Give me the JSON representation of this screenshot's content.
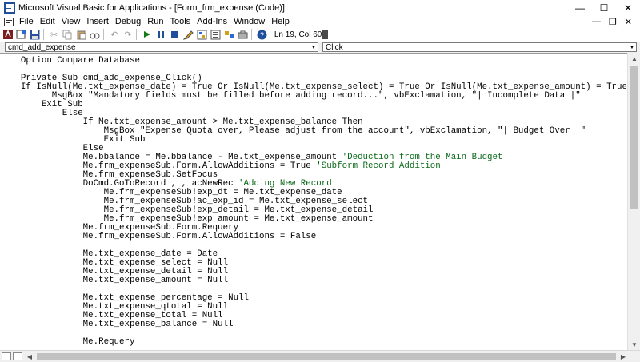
{
  "window": {
    "title": "Microsoft Visual Basic for Applications - [Form_frm_expense (Code)]",
    "minimize": "—",
    "maximize": "☐",
    "close": "✕"
  },
  "menu": {
    "items": [
      "File",
      "Edit",
      "View",
      "Insert",
      "Debug",
      "Run",
      "Tools",
      "Add-Ins",
      "Window",
      "Help"
    ],
    "mdi_min": "—",
    "mdi_restore": "❐",
    "mdi_close": "✕"
  },
  "toolbar": {
    "status": "Ln 19, Col 60"
  },
  "dropdowns": {
    "object": "cmd_add_expense",
    "procedure": "Click"
  },
  "code": [
    {
      "t": "    Option Compare Database",
      "c": ""
    },
    {
      "t": "",
      "c": ""
    },
    {
      "t": "    Private Sub cmd_add_expense_Click()",
      "c": ""
    },
    {
      "t": "    If IsNull(Me.txt_expense_date) = True Or IsNull(Me.txt_expense_select) = True Or IsNull(Me.txt_expense_amount) = True Then",
      "c": ""
    },
    {
      "t": "          MsgBox \"Mandatory fields must be filled before adding record...\", vbExclamation, \"| Incomplete Data |\"",
      "c": ""
    },
    {
      "t": "        Exit Sub",
      "c": ""
    },
    {
      "t": "            Else",
      "c": ""
    },
    {
      "t": "                If Me.txt_expense_amount > Me.txt_expense_balance Then",
      "c": ""
    },
    {
      "t": "                    MsgBox \"Expense Quota over, Please adjust from the account\", vbExclamation, \"| Budget Over |\"",
      "c": ""
    },
    {
      "t": "                    Exit Sub",
      "c": ""
    },
    {
      "t": "                Else",
      "c": ""
    },
    {
      "t": "                Me.bbalance = Me.bbalance - Me.txt_expense_amount ",
      "c": "'Deduction from the Main Budget"
    },
    {
      "t": "                Me.frm_expenseSub.Form.AllowAdditions = True ",
      "c": "'Subform Record Addition"
    },
    {
      "t": "                Me.frm_expenseSub.SetFocus",
      "c": ""
    },
    {
      "t": "                DoCmd.GoToRecord , , acNewRec ",
      "c": "'Adding New Record"
    },
    {
      "t": "                    Me.frm_expenseSub!exp_dt = Me.txt_expense_date",
      "c": ""
    },
    {
      "t": "                    Me.frm_expenseSub!ac_exp_id = Me.txt_expense_select",
      "c": ""
    },
    {
      "t": "                    Me.frm_expenseSub!exp_detail = Me.txt_expense_detail",
      "c": ""
    },
    {
      "t": "                    Me.frm_expenseSub!exp_amount = Me.txt_expense_amount",
      "c": ""
    },
    {
      "t": "                Me.frm_expenseSub.Form.Requery",
      "c": ""
    },
    {
      "t": "                Me.frm_expenseSub.Form.AllowAdditions = False",
      "c": ""
    },
    {
      "t": "",
      "c": ""
    },
    {
      "t": "                Me.txt_expense_date = Date",
      "c": ""
    },
    {
      "t": "                Me.txt_expense_select = Null",
      "c": ""
    },
    {
      "t": "                Me.txt_expense_detail = Null",
      "c": ""
    },
    {
      "t": "                Me.txt_expense_amount = Null",
      "c": ""
    },
    {
      "t": "",
      "c": ""
    },
    {
      "t": "                Me.txt_expense_percentage = Null",
      "c": ""
    },
    {
      "t": "                Me.txt_expense_qtotal = Null",
      "c": ""
    },
    {
      "t": "                Me.txt_expense_total = Null",
      "c": ""
    },
    {
      "t": "                Me.txt_expense_balance = Null",
      "c": ""
    },
    {
      "t": "",
      "c": ""
    },
    {
      "t": "                Me.Requery",
      "c": ""
    }
  ],
  "colors": {
    "comment": "#0b6a1a",
    "code": "#000000"
  }
}
